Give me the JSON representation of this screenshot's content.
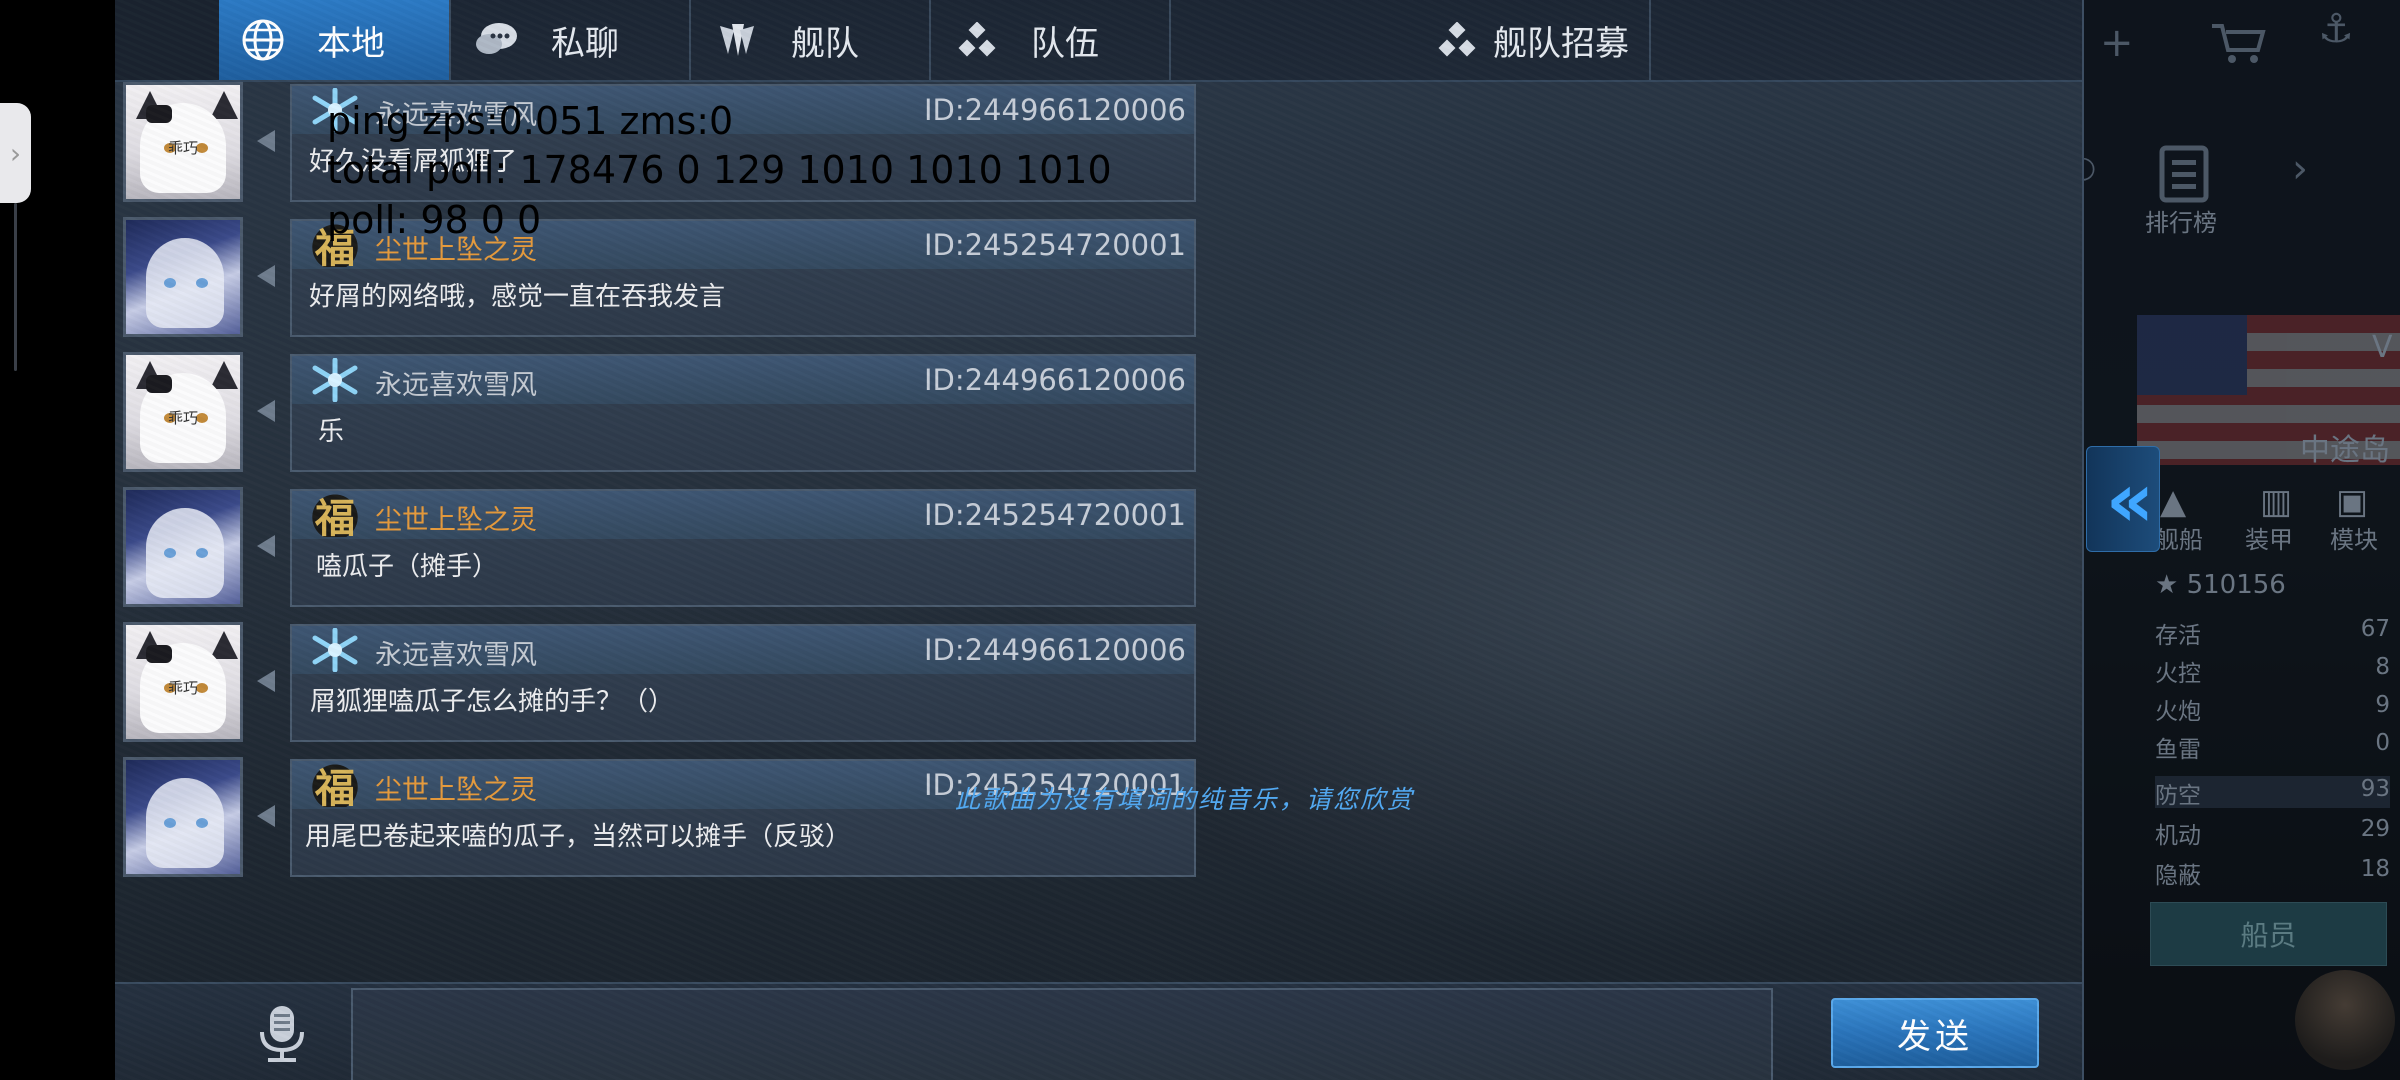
{
  "tabs": [
    {
      "label": "本地",
      "icon": "globe-icon",
      "active": true
    },
    {
      "label": "私聊",
      "icon": "chat-bubble-icon",
      "active": false
    },
    {
      "label": "舰队",
      "icon": "fleet-shield-icon",
      "active": false
    },
    {
      "label": "队伍",
      "icon": "team-dots-icon",
      "active": false
    },
    {
      "label": "舰队招募",
      "icon": "team-dots-icon",
      "active": false
    }
  ],
  "messages": [
    {
      "name": "永远喜欢雪风",
      "uid": "ID:244966120006",
      "text": "好久没看屑狐狸了",
      "badge": "snowflake",
      "avatar": "cat",
      "avatar_label": "乖巧"
    },
    {
      "name": "尘世上坠之灵",
      "uid": "ID:245254720001",
      "text": "好屑的网络哦，感觉一直在吞我发言",
      "badge": "福",
      "avatar": "girl"
    },
    {
      "name": "永远喜欢雪风",
      "uid": "ID:244966120006",
      "text": "乐",
      "badge": "snowflake",
      "avatar": "cat",
      "avatar_label": "乖巧"
    },
    {
      "name": "尘世上坠之灵",
      "uid": "ID:245254720001",
      "text": "嗑瓜子（摊手）",
      "badge": "福",
      "avatar": "girl"
    },
    {
      "name": "永远喜欢雪风",
      "uid": "ID:244966120006",
      "text": "屑狐狸嗑瓜子怎么摊的手？（）",
      "badge": "snowflake",
      "avatar": "cat",
      "avatar_label": "乖巧"
    },
    {
      "name": "尘世上坠之灵",
      "uid": "ID:245254720001",
      "text": "用尾巴卷起来嗑的瓜子，当然可以摊手（反驳）",
      "badge": "福",
      "avatar": "girl"
    }
  ],
  "debug": {
    "line1": "ping zps:0.051 zms:0",
    "line2": "total poll: 178476 0 129 1010 1010 1010",
    "line3": "poll: 98 0 0"
  },
  "marquee": "此歌曲为没有填词的纯音乐，请您欣赏",
  "input": {
    "value": "",
    "placeholder": ""
  },
  "send_label": "发送",
  "background_panel": {
    "ship_name": "中途岛",
    "power": "510156",
    "tabs": [
      "舰船",
      "装甲",
      "模块"
    ],
    "ranking": "排行榜",
    "stats": [
      {
        "label": "存活",
        "value": "67"
      },
      {
        "label": "火控",
        "value": "8"
      },
      {
        "label": "火炮",
        "value": "9"
      },
      {
        "label": "鱼雷",
        "value": "0"
      },
      {
        "label": "防空",
        "value": "93"
      },
      {
        "label": "机动",
        "value": "29"
      },
      {
        "label": "隐蔽",
        "value": "18"
      }
    ],
    "crew_button": "船员"
  },
  "colors": {
    "accent": "#2a74bb",
    "name_orange": "#e59a3c",
    "marquee_blue": "#52a8f0"
  }
}
